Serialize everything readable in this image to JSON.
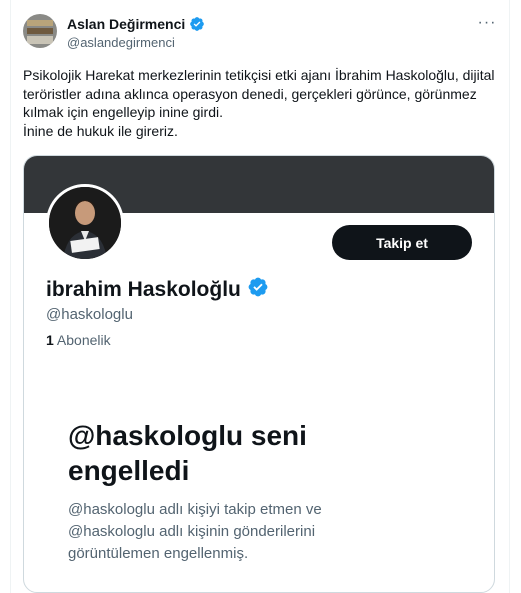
{
  "tweet": {
    "author": {
      "display_name": "Aslan Değirmenci",
      "handle": "@aslandegirmenci",
      "verified_icon": "verified-badge-icon"
    },
    "more_icon": "more-horizontal-icon",
    "text": "Psikolojik Harekat merkezlerinin tetikçisi etki ajanı İbrahim Haskoloğlu, dijital teröristler adına aklınca operasyon denedi, gerçekleri görünce, görünmez kılmak için engelleyip inine girdi.\nİnine de hukuk ile gireriz."
  },
  "embedded_profile": {
    "display_name": "ibrahim Haskoloğlu",
    "handle": "@haskologlu",
    "following_count": "1",
    "following_label": "Abonelik",
    "follow_button": "Takip et",
    "blocked_title": "@haskologlu seni engelledi",
    "blocked_description": "@haskologlu adlı kişiyi takip etmen ve @haskologlu adlı kişinin gönderilerini görüntülemen engellenmiş."
  },
  "colors": {
    "verified_blue": "#1d9bf0",
    "banner": "#333639",
    "button_bg": "#0f1419",
    "secondary_text": "#536471"
  }
}
